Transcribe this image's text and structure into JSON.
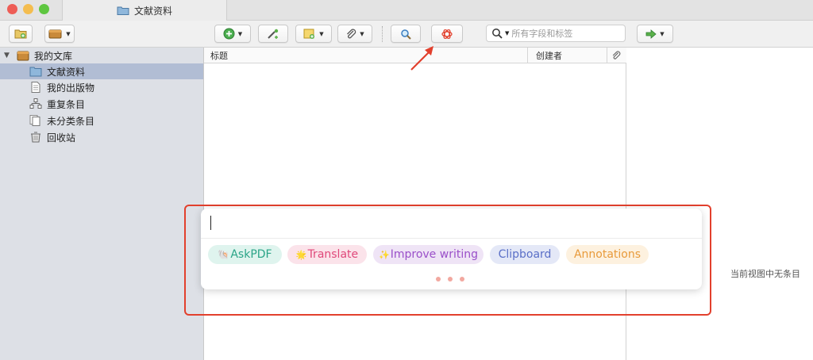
{
  "window": {
    "tab_title": "文献资料"
  },
  "toolbar": {
    "new_collection_icon": "folder-add-icon",
    "new_library_icon": "library-menu-icon",
    "new_item_icon": "plus-circle-icon",
    "add_by_identifier_icon": "magic-wand-icon",
    "new_note_icon": "note-icon",
    "attachment_icon": "paperclip-icon",
    "advanced_search_icon": "magnifier-icon",
    "chatgpt_icon": "openai-icon",
    "search_placeholder": "所有字段和标签",
    "locate_icon": "arrow-right-icon"
  },
  "sidebar": {
    "items": [
      {
        "label": "我的文库",
        "icon": "library-icon"
      },
      {
        "label": "文献资料",
        "icon": "folder-icon"
      },
      {
        "label": "我的出版物",
        "icon": "document-icon"
      },
      {
        "label": "重复条目",
        "icon": "duplicate-icon"
      },
      {
        "label": "未分类条目",
        "icon": "unfiled-icon"
      },
      {
        "label": "回收站",
        "icon": "trash-icon"
      }
    ]
  },
  "items_table": {
    "columns": [
      "标题",
      "创建者"
    ],
    "attachment_column_icon": "paperclip-icon"
  },
  "item_pane": {
    "empty_message": "当前视图中无条目"
  },
  "popup": {
    "input_value": "",
    "chips": [
      {
        "label": "AskPDF",
        "emoji": "🐚",
        "color": "#2aa487",
        "bg": "#dff4ee"
      },
      {
        "label": "Translate",
        "emoji": "🌟",
        "color": "#e0487a",
        "bg": "#fbe3ea"
      },
      {
        "label": "Improve writing",
        "emoji": "✨",
        "color": "#9a4fc9",
        "bg": "#efe4f6"
      },
      {
        "label": "Clipboard",
        "emoji": "",
        "color": "#5a6fc7",
        "bg": "#e4e8f7"
      },
      {
        "label": "Annotations",
        "emoji": "",
        "color": "#e89a3a",
        "bg": "#fdf1df"
      }
    ]
  },
  "colors": {
    "highlight": "#e2402d",
    "sidebar_bg": "#dde0e6",
    "selected_bg": "#b1bdd4"
  }
}
